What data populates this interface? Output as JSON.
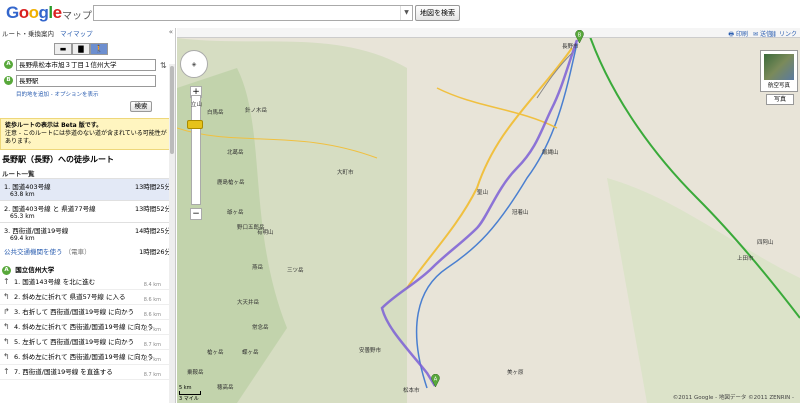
{
  "header": {
    "logo": "Google",
    "logo_sub": "マップ",
    "search_placeholder": "",
    "search_button": "地図を検索"
  },
  "panel": {
    "tab_label": "ルート・乗換案内",
    "tab_link": "マイマップ",
    "collapse": "«",
    "modes": [
      {
        "icon": "car-icon",
        "glyph": "▬"
      },
      {
        "icon": "transit-icon",
        "glyph": "▇"
      },
      {
        "icon": "walk-icon",
        "glyph": "✈"
      }
    ],
    "from": {
      "pin": "A",
      "value": "長野県松本市旭３丁目１信州大学"
    },
    "to": {
      "pin": "B",
      "value": "長野駅"
    },
    "add_link": "目的地を追加 - オプションを表示",
    "search_btn": "検索",
    "beta_title": "徒歩ルートの表示は Beta 版です。",
    "beta_text": "注意 - このルートには歩道のない道が含まれている可能性があります。",
    "route_title": "長野駅（長野）への徒歩ルート",
    "list_header": "ルート一覧",
    "alternatives": [
      {
        "name": "1. 国道403号線",
        "dist": "63.8 km",
        "time": "13時間25分",
        "selected": true
      },
      {
        "name": "2. 国道403号線 と 県道77号線",
        "dist": "65.3 km",
        "time": "13時間52分",
        "selected": false
      },
      {
        "name": "3. 西街道/国道19号線",
        "dist": "69.4 km",
        "time": "14時間25分",
        "selected": false
      }
    ],
    "transit": {
      "label": "公共交通機関を使う",
      "sub": "（電車）",
      "time": "1時間26分"
    },
    "origin": {
      "pin": "A",
      "label": "国立信州大学"
    },
    "steps": [
      {
        "text": "1. 国道143号線 を北に進む",
        "dist": "8.4 km"
      },
      {
        "text": "2. 斜め左に折れて 県道57号線 に入る",
        "dist": "8.6 km"
      },
      {
        "text": "3. 右折して 西街道/国道19号線 に向かう",
        "dist": "8.6 km"
      },
      {
        "text": "4. 斜め左に折れて 西街道/国道19号線 に向かう",
        "dist": "8.7 km"
      },
      {
        "text": "5. 左折して 西街道/国道19号線 に向かう",
        "dist": "8.7 km"
      },
      {
        "text": "6. 斜め左に折れて 西街道/国道19号線 に向かう",
        "dist": "8.7 km"
      },
      {
        "text": "7. 西街道/国道19号線 を直進する",
        "dist": "8.7 km"
      }
    ]
  },
  "map": {
    "toolbar": {
      "print": "印刷",
      "send": "送信",
      "link": "リンク"
    },
    "aerial": "航空写真",
    "photo": "写真",
    "scale_km": "5 km",
    "scale_mi": "3 マイル",
    "copyright": "©2011 Google - 地図データ ©2011 ZENRIN -",
    "labels": [
      "長野市",
      "大町市",
      "上田市",
      "安曇野市",
      "松本市",
      "聖山",
      "冠着山",
      "四阿山",
      "白馬岳",
      "鹿島槍ヶ岳",
      "爺ヶ岳",
      "有明山",
      "燕岳",
      "大天井岳",
      "常念岳",
      "蝶ヶ岳",
      "槍ヶ岳",
      "穂高岳",
      "乗鞍岳",
      "美ヶ原",
      "立山",
      "針ノ木岳",
      "北葛岳",
      "野口五郎岳",
      "三ツ岳",
      "飯縄山"
    ]
  }
}
